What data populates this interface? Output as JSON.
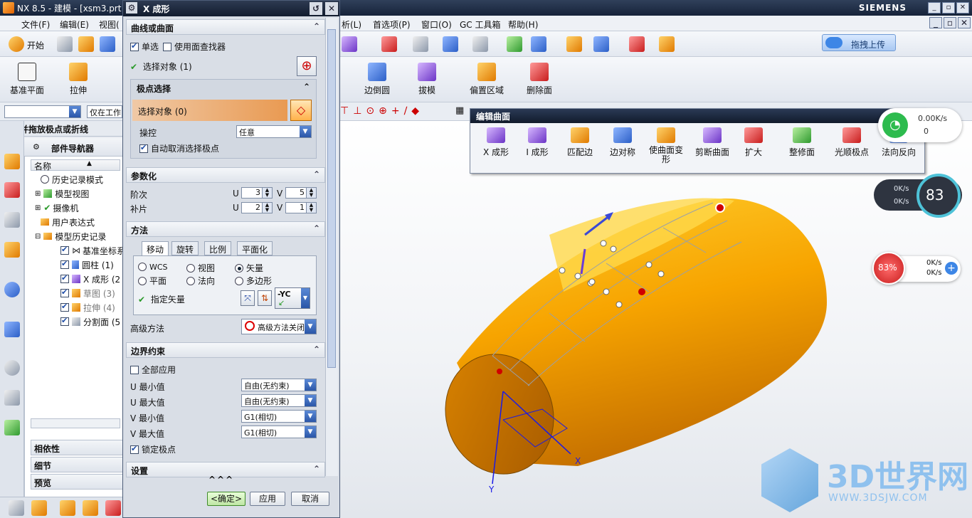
{
  "window": {
    "title": "NX 8.5 - 建模 - [xsm3.prt",
    "brand": "SIEMENS",
    "controls": [
      "_",
      "▫",
      "✕"
    ]
  },
  "menubar": {
    "items": [
      "文件(F)",
      "编辑(E)",
      "视图(",
      "析(L)",
      "首选项(P)",
      "窗口(O)",
      "GC 工具箱",
      "帮助(H)"
    ],
    "right_controls": [
      "_",
      "▫",
      "✕"
    ]
  },
  "toolbar": {
    "start_label": "开始",
    "upload_label": "拖拽上传",
    "big_buttons": [
      "基准平面",
      "拉伸",
      "边倒圆",
      "拔模",
      "偏置区域",
      "删除面"
    ]
  },
  "selection_bar": {
    "filter_value": "仅在工作",
    "hint": "选择并拖放极点或折线",
    "count": "0"
  },
  "navigator": {
    "title": "部件导航器",
    "column_header": "名称",
    "items": [
      {
        "label": "历史记录模式",
        "indent": 1
      },
      {
        "label": "模型视图",
        "indent": 0
      },
      {
        "label": "摄像机",
        "indent": 0
      },
      {
        "label": "用户表达式",
        "indent": 1
      },
      {
        "label": "模型历史记录",
        "indent": 0
      },
      {
        "label": "基准坐标系",
        "indent": 2
      },
      {
        "label": "圆柱 (1)",
        "indent": 2
      },
      {
        "label": "X 成形 (2",
        "indent": 2
      },
      {
        "label": "草图 (3)",
        "indent": 2
      },
      {
        "label": "拉伸 (4)",
        "indent": 2
      },
      {
        "label": "分割面 (5",
        "indent": 2
      }
    ],
    "bottom_sections": [
      "相依性",
      "细节",
      "预览"
    ]
  },
  "dialog": {
    "title": "X 成形",
    "curve_surface": {
      "header": "曲线或曲面",
      "single_select_label": "单选",
      "face_finder_label": "使用面查找器",
      "select_object_label": "选择对象 (1)"
    },
    "pole_selection": {
      "header": "极点选择",
      "select_object_label": "选择对象 (0)",
      "manip_label": "操控",
      "manip_value": "任意",
      "auto_deselect_label": "自动取消选择极点"
    },
    "parameterize": {
      "header": "参数化",
      "degree_label": "阶次",
      "patch_label": "补片",
      "u_letter": "U",
      "v_letter": "V",
      "degree_u": "3",
      "degree_v": "5",
      "patch_u": "2",
      "patch_v": "1"
    },
    "method": {
      "header": "方法",
      "tabs": [
        "移动",
        "旋转",
        "比例",
        "平面化"
      ],
      "options": [
        "WCS",
        "视图",
        "矢量",
        "平面",
        "法向",
        "多边形"
      ],
      "selected": "矢量",
      "specify_vector_label": "指定矢量",
      "vector_value": "-YC",
      "advanced_label": "高级方法",
      "advanced_value": "高级方法关闭"
    },
    "boundary": {
      "header": "边界约束",
      "apply_all_label": "全部应用",
      "rows": [
        {
          "label": "U 最小值",
          "value": "自由(无约束)"
        },
        {
          "label": "U 最大值",
          "value": "自由(无约束)"
        },
        {
          "label": "V 最小值",
          "value": "G1(相切)"
        },
        {
          "label": "V 最大值",
          "value": "G1(相切)"
        }
      ],
      "lock_poles_label": "锁定极点"
    },
    "settings_header": "设置",
    "buttons": {
      "ok": "<确定>",
      "apply": "应用",
      "cancel": "取消"
    }
  },
  "edit_surface_toolbar": {
    "title": "编辑曲面",
    "buttons": [
      "X 成形",
      "I 成形",
      "匹配边",
      "边对称",
      "使曲面变形",
      "剪断曲面",
      "扩大",
      "整修面",
      "光顺极点",
      "法向反向"
    ]
  },
  "widgets": {
    "net_speed": "0.00K/s",
    "net_count": "0",
    "cpu_up": "0K/s",
    "cpu_down": "0K/s",
    "cpu_percent": "83",
    "mem_percent": "83%",
    "mem_up": "0K/s",
    "mem_down": "0K/s"
  },
  "viewport": {
    "axis_x": "X",
    "axis_y": "Y",
    "watermark_title": "3D世界网",
    "watermark_url": "WWW.3DSJW.COM"
  },
  "colors": {
    "model": "#f5a000",
    "title_dark": "#16233a",
    "accent_blue": "#2a56a8"
  }
}
